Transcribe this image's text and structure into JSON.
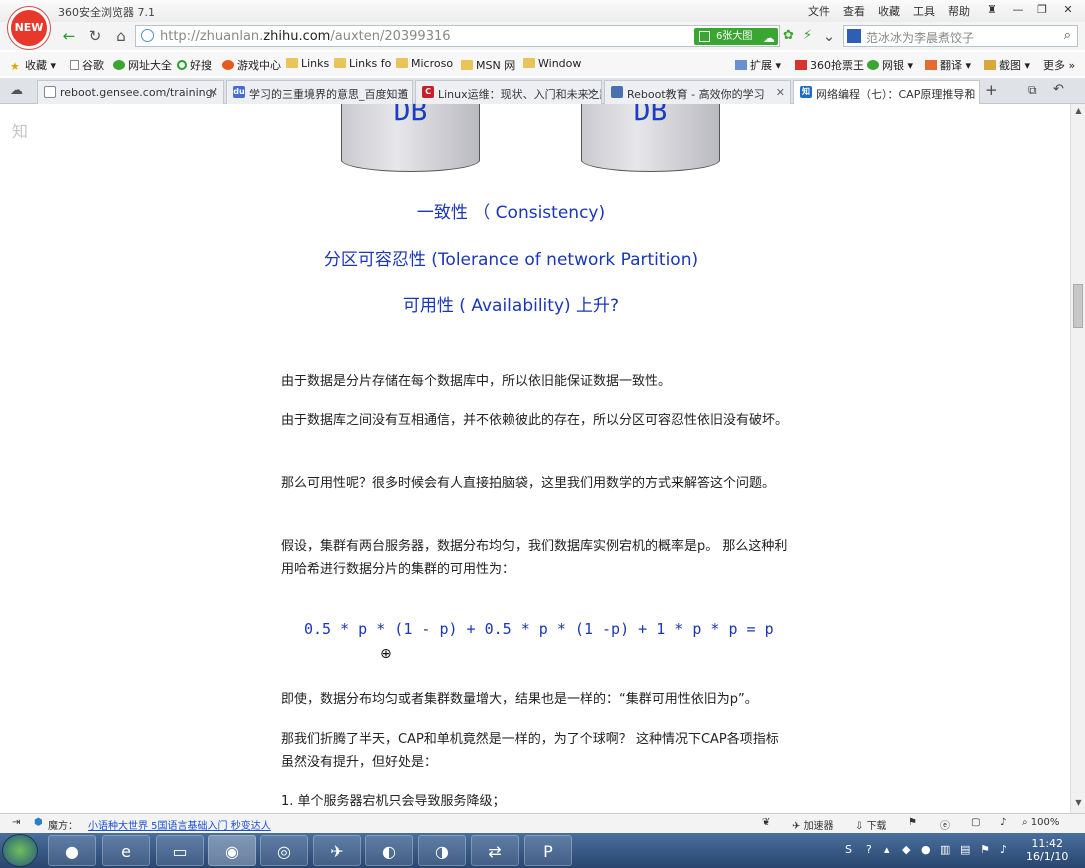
{
  "window": {
    "app_title": "360安全浏览器 7.1",
    "logo_text": "NEW",
    "menus": [
      "文件",
      "查看",
      "收藏",
      "工具",
      "帮助"
    ]
  },
  "nav": {
    "url_prefix": "http://zhuanlan.",
    "url_domain": "zhihu.com",
    "url_path": "/auxten/20399316",
    "big_image_button": "6张大图",
    "search_value": "范冰冰为李晨煮饺子"
  },
  "bookmarks": [
    "收藏",
    "谷歌",
    "网址大全",
    "好搜",
    "游戏中心",
    "Links",
    "Links fo",
    "Microso",
    "MSN 网",
    "Window"
  ],
  "bookmarks_right": [
    "扩展",
    "360抢票王",
    "网银",
    "翻译",
    "截图",
    "更多"
  ],
  "tabs": [
    {
      "label": "reboot.gensee.com/training/",
      "fav": "#6a8bc7",
      "favtext": ""
    },
    {
      "label": "学习的三重境界的意思_百度知道",
      "fav": "#3f6fd1",
      "favtext": "du"
    },
    {
      "label": "Linux运维：现状、入门和未来之路",
      "fav": "#c8202a",
      "favtext": "C"
    },
    {
      "label": "Reboot教育 - 高效你的学习",
      "fav": "#4a70b0",
      "favtext": ""
    },
    {
      "label": "网络编程（七）：CAP原理推导和",
      "fav": "#1d6cc9",
      "favtext": "知"
    }
  ],
  "article": {
    "side_logo": "知",
    "db_labels": [
      "DB",
      "DB"
    ],
    "consistency": "一致性 （ Consistency)",
    "partition": "分区可容忍性 (Tolerance of network Partition)",
    "availability": "可用性 ( Availability) 上升?",
    "p1": "由于数据是分片存储在每个数据库中，所以依旧能保证数据一致性。",
    "p2": "由于数据库之间没有互相通信，并不依赖彼此的存在，所以分区可容忍性依旧没有破坏。",
    "p3": "那么可用性呢？很多时候会有人直接拍脑袋，这里我们用数学的方式来解答这个问题。",
    "p4": "假设，集群有两台服务器，数据分布均匀，我们数据库实例宕机的概率是p。 那么这种利用哈希进行数据分片的集群的可用性为：",
    "formula": "0.5 * p * (1 - p) + 0.5 * p * (1 -p) + 1 * p * p = p",
    "p5": "即使，数据分布均匀或者集群数量增大，结果也是一样的：“集群可用性依旧为p”。",
    "p6": "那我们折腾了半天，CAP和单机竟然是一样的，为了个球啊？ 这种情况下CAP各项指标虽然没有提升，但好处是：",
    "li1": "1. 单个服务器宕机只会导致服务降级；"
  },
  "status": {
    "magic_label": "魔方：",
    "magic_link": "小语种大世界 5国语言基础入门 秒变达人",
    "accelerator": "加速器",
    "download": "下载",
    "zoom": "100%"
  },
  "taskbar": {
    "time": "11:42",
    "date": "16/1/10"
  },
  "colors": {
    "accent_blue": "#1a36b8",
    "green_button": "#3aa531",
    "logo_red": "#e8372b"
  }
}
